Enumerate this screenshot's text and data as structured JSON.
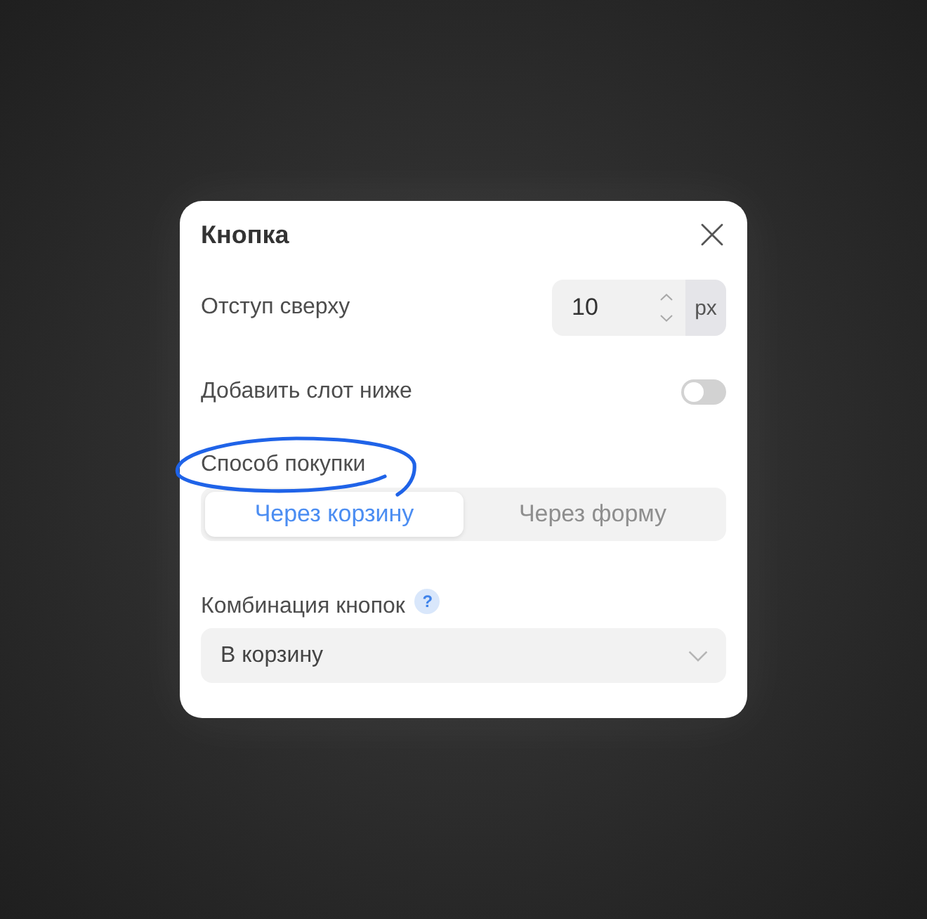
{
  "dialog": {
    "title": "Кнопка"
  },
  "fields": [
    {
      "kind": "number",
      "label": "Отступ сверху",
      "value": "10",
      "unit": "px"
    },
    {
      "kind": "toggle",
      "label": "Добавить слот ниже",
      "on": false
    },
    {
      "kind": "segmented",
      "label": "Способ покупки",
      "highlighted": true,
      "options": [
        {
          "label": "Через корзину",
          "selected": true
        },
        {
          "label": "Через форму",
          "selected": false
        }
      ]
    },
    {
      "kind": "select",
      "label": "Комбинация кнопок",
      "help": "?",
      "value": "В корзину"
    }
  ]
}
